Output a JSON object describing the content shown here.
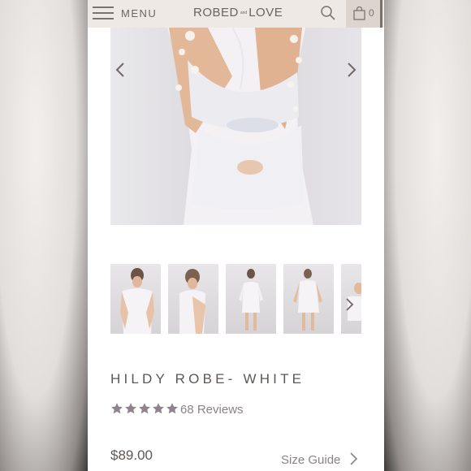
{
  "header": {
    "menu_label": "MENU",
    "brand_left": "ROBED",
    "brand_mid": "and",
    "brand_right": "LOVE",
    "cart_count": "0"
  },
  "gallery": {
    "thumbnail_count": 5
  },
  "product": {
    "title": "HILDY ROBE- WHITE",
    "rating": 5,
    "reviews": "68 Reviews",
    "price": "$89.00",
    "size_guide": "Size Guide"
  },
  "colors": {
    "header_bg": "#efe9e5",
    "star": "#8f848e",
    "text": "#5d5854"
  }
}
